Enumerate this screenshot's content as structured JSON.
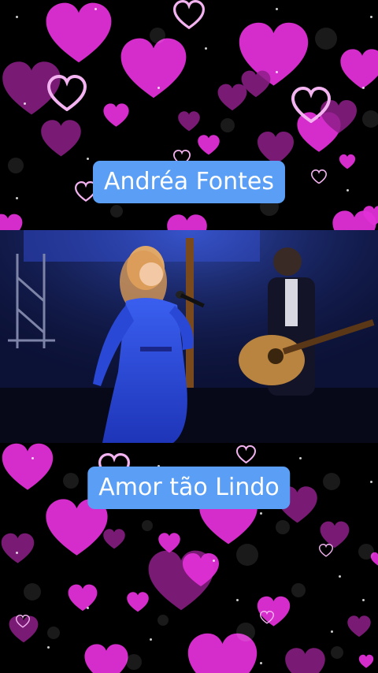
{
  "title_top": "Andréa Fontes",
  "title_bottom": "Amor tão Lindo",
  "colors": {
    "background": "#000000",
    "heart_fill": "#e02fd6",
    "heart_fill_dark": "#8e1f89",
    "heart_outline": "#f3b3f0",
    "label_bg": "#5a9ff5",
    "label_text": "#ffffff"
  },
  "video": {
    "scene": "concert-stage",
    "icons": [
      "singer-figure",
      "microphone-icon",
      "guitarist-figure",
      "acoustic-guitar-icon",
      "stage-truss"
    ]
  }
}
